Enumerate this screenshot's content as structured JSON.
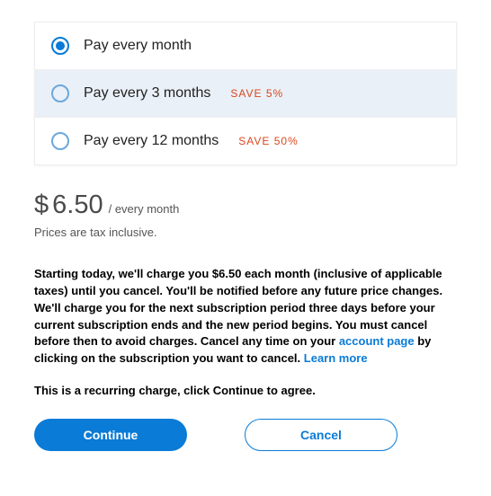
{
  "options": [
    {
      "label": "Pay every month",
      "save": "",
      "selected": true,
      "highlight": false
    },
    {
      "label": "Pay every 3 months",
      "save": "SAVE 5%",
      "selected": false,
      "highlight": true
    },
    {
      "label": "Pay every 12 months",
      "save": "SAVE 50%",
      "selected": false,
      "highlight": false
    }
  ],
  "price": {
    "currency": "$",
    "amount": "6.50",
    "period": "/ every month",
    "tax_note": "Prices are tax inclusive."
  },
  "terms": {
    "t1": "Starting today, we'll charge you $6.50 each month (inclusive of applicable taxes) until you cancel. You'll be notified before any future price changes. We'll charge you for the next subscription period three days before your current subscription ends and the new period begins. You must cancel before then to avoid charges. Cancel any time on your ",
    "link1": "account page",
    "t2": " by clicking on the subscription you want to cancel. ",
    "link2": "Learn more"
  },
  "recurring_note": "This is a recurring charge, click Continue to agree.",
  "buttons": {
    "continue": "Continue",
    "cancel": "Cancel"
  }
}
